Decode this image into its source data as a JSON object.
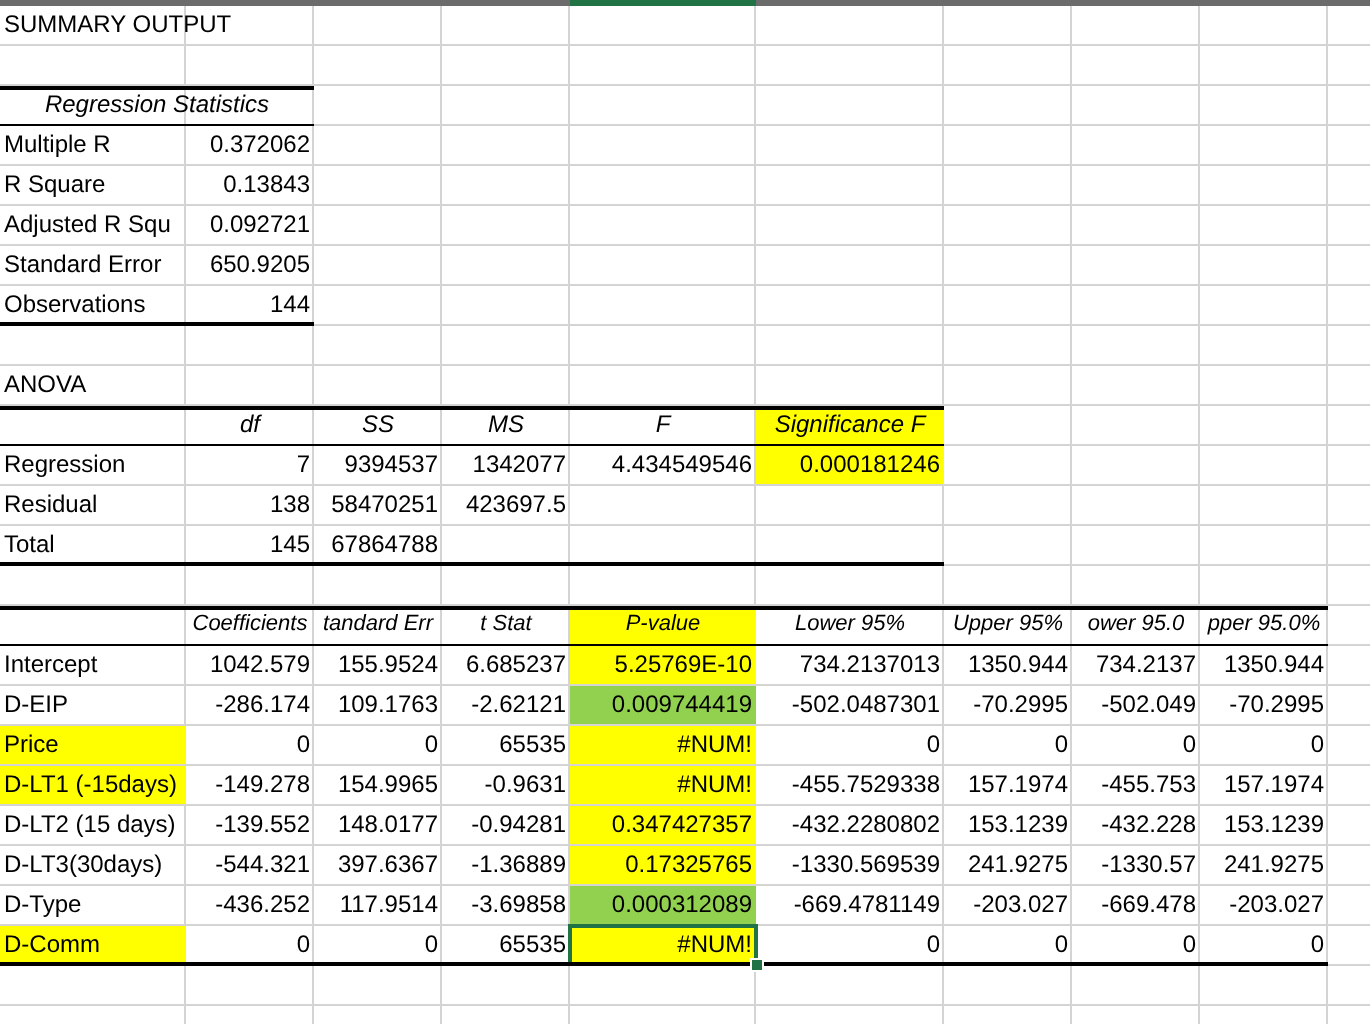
{
  "title": "SUMMARY OUTPUT",
  "regression_statistics": {
    "heading": "Regression Statistics",
    "rows": [
      {
        "label": "Multiple R",
        "value": "0.372062"
      },
      {
        "label": "R Square",
        "value": "0.13843"
      },
      {
        "label": "Adjusted R Squ",
        "value": "0.092721"
      },
      {
        "label": "Standard Error",
        "value": "650.9205"
      },
      {
        "label": "Observations",
        "value": "144"
      }
    ]
  },
  "anova": {
    "title": "ANOVA",
    "columns": [
      {
        "label": "df"
      },
      {
        "label": "SS"
      },
      {
        "label": "MS"
      },
      {
        "label": "F"
      },
      {
        "label": "Significance F",
        "color": "#ffff00"
      }
    ],
    "rows": [
      {
        "label": "Regression",
        "cells": [
          {
            "text": "7"
          },
          {
            "text": "9394537"
          },
          {
            "text": "1342077"
          },
          {
            "text": "4.434549546"
          },
          {
            "text": "0.000181246",
            "color": "#ffff00"
          }
        ]
      },
      {
        "label": "Residual",
        "cells": [
          {
            "text": "138"
          },
          {
            "text": "58470251"
          },
          {
            "text": "423697.5"
          }
        ]
      },
      {
        "label": "Total",
        "cells": [
          {
            "text": "145"
          },
          {
            "text": "67864788"
          }
        ]
      }
    ]
  },
  "coefficients": {
    "columns": [
      {
        "label": "Coefficients"
      },
      {
        "label": "tandard Err"
      },
      {
        "label": "t Stat"
      },
      {
        "label": "P-value",
        "color": "#ffff00"
      },
      {
        "label": "Lower 95%"
      },
      {
        "label": "Upper 95%"
      },
      {
        "label": "ower 95.0"
      },
      {
        "label": "pper 95.0%"
      }
    ],
    "rows": [
      {
        "label": {
          "text": "Intercept"
        },
        "selected": false,
        "cells": [
          {
            "text": "1042.579"
          },
          {
            "text": "155.9524"
          },
          {
            "text": "6.685237"
          },
          {
            "text": "5.25769E-10",
            "color": "#ffff00"
          },
          {
            "text": "734.2137013"
          },
          {
            "text": "1350.944"
          },
          {
            "text": "734.2137"
          },
          {
            "text": "1350.944"
          }
        ]
      },
      {
        "label": {
          "text": "D-EIP"
        },
        "selected": false,
        "cells": [
          {
            "text": "-286.174"
          },
          {
            "text": "109.1763"
          },
          {
            "text": "-2.62121"
          },
          {
            "text": "0.009744419",
            "color": "#92d050"
          },
          {
            "text": "-502.0487301"
          },
          {
            "text": "-70.2995"
          },
          {
            "text": "-502.049"
          },
          {
            "text": "-70.2995"
          }
        ]
      },
      {
        "label": {
          "text": "Price",
          "color": "#ffff00"
        },
        "selected": false,
        "cells": [
          {
            "text": "0"
          },
          {
            "text": "0"
          },
          {
            "text": "65535"
          },
          {
            "text": "#NUM!",
            "color": "#ffff00"
          },
          {
            "text": "0"
          },
          {
            "text": "0"
          },
          {
            "text": "0"
          },
          {
            "text": "0"
          }
        ]
      },
      {
        "label": {
          "text": "D-LT1 (-15days)",
          "color": "#ffff00"
        },
        "selected": false,
        "cells": [
          {
            "text": "-149.278"
          },
          {
            "text": "154.9965"
          },
          {
            "text": "-0.9631"
          },
          {
            "text": "#NUM!",
            "color": "#ffff00"
          },
          {
            "text": "-455.7529338"
          },
          {
            "text": "157.1974"
          },
          {
            "text": "-455.753"
          },
          {
            "text": "157.1974"
          }
        ]
      },
      {
        "label": {
          "text": "D-LT2 (15 days)"
        },
        "selected": false,
        "cells": [
          {
            "text": "-139.552"
          },
          {
            "text": "148.0177"
          },
          {
            "text": "-0.94281"
          },
          {
            "text": "0.347427357",
            "color": "#ffff00"
          },
          {
            "text": "-432.2280802"
          },
          {
            "text": "153.1239"
          },
          {
            "text": "-432.228"
          },
          {
            "text": "153.1239"
          }
        ]
      },
      {
        "label": {
          "text": "D-LT3(30days)"
        },
        "selected": false,
        "cells": [
          {
            "text": "-544.321"
          },
          {
            "text": "397.6367"
          },
          {
            "text": "-1.36889"
          },
          {
            "text": "0.17325765",
            "color": "#ffff00"
          },
          {
            "text": "-1330.569539"
          },
          {
            "text": "241.9275"
          },
          {
            "text": "-1330.57"
          },
          {
            "text": "241.9275"
          }
        ]
      },
      {
        "label": {
          "text": "D-Type"
        },
        "selected": false,
        "cells": [
          {
            "text": "-436.252"
          },
          {
            "text": "117.9514"
          },
          {
            "text": "-3.69858"
          },
          {
            "text": "0.000312089",
            "color": "#92d050"
          },
          {
            "text": "-669.4781149"
          },
          {
            "text": "-203.027"
          },
          {
            "text": "-669.478"
          },
          {
            "text": "-203.027"
          }
        ]
      },
      {
        "label": {
          "text": "D-Comm",
          "color": "#ffff00"
        },
        "selected": true,
        "cells": [
          {
            "text": "0"
          },
          {
            "text": "0"
          },
          {
            "text": "65535"
          },
          {
            "text": "#NUM!",
            "color": "#ffff00"
          },
          {
            "text": "0"
          },
          {
            "text": "0"
          },
          {
            "text": "0"
          },
          {
            "text": "0"
          }
        ]
      }
    ]
  }
}
